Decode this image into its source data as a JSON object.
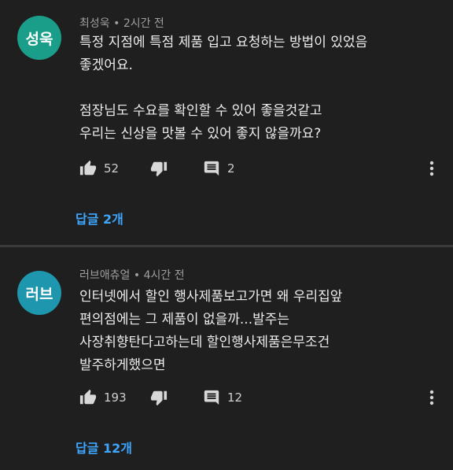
{
  "comments": [
    {
      "avatar_text": "성욱",
      "avatar_color": "#1a9e8a",
      "author": "최성욱",
      "time": "2시간 전",
      "lines": [
        "특정 지점에 특점 제품 입고 요청하는 방법이 있었음",
        "좋겠어요.",
        "",
        "점장님도 수요를 확인할 수 있어 좋을것같고",
        "우리는 신상을 맛볼 수 있어 좋지 않을까요?"
      ],
      "likes": "52",
      "replies_count": "2",
      "replies_link": "답글 2개"
    },
    {
      "avatar_text": "러브",
      "avatar_color": "#1e96ad",
      "author": "러브애츄얼",
      "time": "4시간 전",
      "lines": [
        "인터넷에서 할인 행사제품보고가면 왜 우리집앞",
        "편의점에는 그 제품이 없을까...발주는",
        "사장취향탄다고하는데 할인행사제품은무조건",
        "발주하게했으면"
      ],
      "likes": "193",
      "replies_count": "12",
      "replies_link": "답글 12개"
    }
  ],
  "separator": "•",
  "colors": {
    "background": "#1f1f1f",
    "link": "#3ea6ff",
    "meta": "#9e9e9e"
  },
  "icons": [
    "thumbs-up-icon",
    "thumbs-down-icon",
    "comment-icon",
    "more-vert-icon"
  ]
}
